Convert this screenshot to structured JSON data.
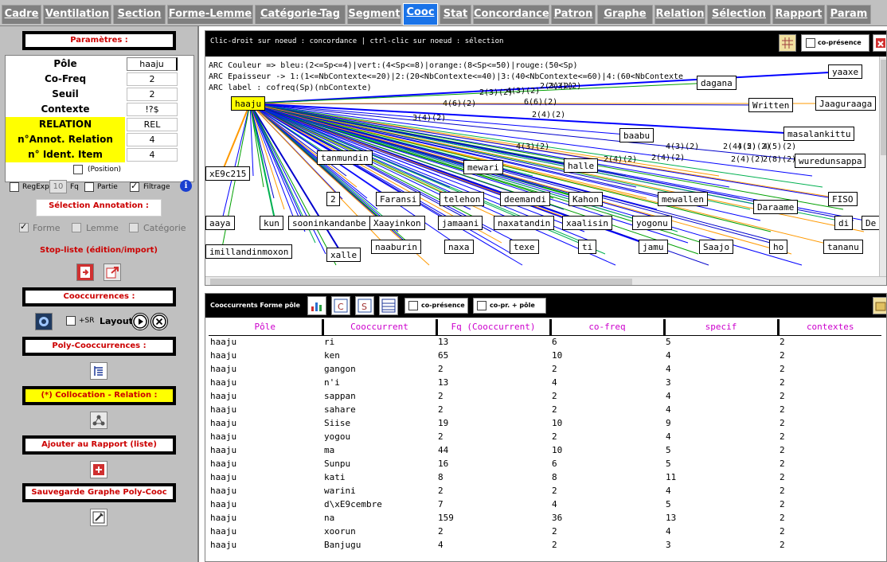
{
  "tabs": [
    {
      "label": "Cadre",
      "active": false
    },
    {
      "label": "Ventilation",
      "active": false
    },
    {
      "label": "Section",
      "active": false
    },
    {
      "label": "Forme-Lemme",
      "active": false
    },
    {
      "label": "Catégorie-Tag",
      "active": false
    },
    {
      "label": "Segment",
      "active": false
    },
    {
      "label": "Cooc",
      "active": true
    },
    {
      "label": "Stat",
      "active": false
    },
    {
      "label": "Concordance",
      "active": false
    },
    {
      "label": "Patron",
      "active": false
    },
    {
      "label": "Graphe",
      "active": false
    },
    {
      "label": "Relation",
      "active": false
    },
    {
      "label": "Sélection",
      "active": false
    },
    {
      "label": "Rapport",
      "active": false
    },
    {
      "label": "Param",
      "active": false
    }
  ],
  "left": {
    "params_title": "Paramètres :",
    "params": [
      {
        "label": "Pôle",
        "value": "haaju",
        "highlight": false
      },
      {
        "label": "Co-Freq",
        "value": "2",
        "highlight": false
      },
      {
        "label": "Seuil",
        "value": "2",
        "highlight": false
      },
      {
        "label": "Contexte",
        "value": "!?$",
        "highlight": false
      },
      {
        "label": "RELATION",
        "value": "REL",
        "highlight": true
      },
      {
        "label": "n°Annot. Relation",
        "value": "4",
        "highlight": true
      },
      {
        "label": "n° Ident. Item",
        "value": "4",
        "highlight": true
      }
    ],
    "position_label": "(Position)",
    "regexp_label": "RegExp",
    "fq_value": "10",
    "fq_label": "Fq",
    "partie_label": "Partie",
    "filtrage_label": "Filtrage",
    "selection_title": "Sélection Annotation :",
    "forme_label": "Forme",
    "lemme_label": "Lemme",
    "categorie_label": "Catégorie",
    "stoplist_label": "Stop-liste (édition/import)",
    "cooccurrences_title": "Cooccurrences :",
    "sr_label": "+SR",
    "layout_label": "Layout",
    "poly_title": "Poly-Cooccurrences :",
    "collocation_title": "(*) Collocation - Relation :",
    "ajouter_title": "Ajouter au Rapport (liste)",
    "sauvegarde_title": "Sauvegarde Graphe Poly-Cooc"
  },
  "graph": {
    "header_text": "Clic-droit sur noeud : concordance | ctrl-clic sur noeud : sélection",
    "copresence_label": "co-présence",
    "legend": [
      "ARC Couleur => bleu:(2<=Sp<=4)|vert:(4<Sp<=8)|orange:(8<Sp<=50)|rouge:(50<Sp)",
      "ARC Epaisseur -> 1:(1<=NbContexte<=20)|2:(20<NbContexte<=40)|3:(40<NbContexte<=60)|4:(60<NbContexte",
      "ARC label : cofreq(Sp)(nbContexte)"
    ],
    "center_node": "haaju",
    "nodes": [
      {
        "label": "yaaxe"
      },
      {
        "label": "dagana"
      },
      {
        "label": "Written"
      },
      {
        "label": "Jaaguraaga"
      },
      {
        "label": "baabu"
      },
      {
        "label": "masalankittu"
      },
      {
        "label": "tanmundin"
      },
      {
        "label": "mewari"
      },
      {
        "label": "halle"
      },
      {
        "label": "wuredunsappa"
      },
      {
        "label": "xE9c215"
      },
      {
        "label": "2"
      },
      {
        "label": "Faransi"
      },
      {
        "label": "telehon"
      },
      {
        "label": "deemandi"
      },
      {
        "label": "Kahon"
      },
      {
        "label": "mewallen"
      },
      {
        "label": "FISO"
      },
      {
        "label": "Daraame"
      },
      {
        "label": "aaya"
      },
      {
        "label": "kun"
      },
      {
        "label": "sooninkandanbe"
      },
      {
        "label": "Xaayinkon"
      },
      {
        "label": "jamaani"
      },
      {
        "label": "naxatandin"
      },
      {
        "label": "xaalisin"
      },
      {
        "label": "yogonu"
      },
      {
        "label": "di"
      },
      {
        "label": "De"
      },
      {
        "label": "imillandinmoxon"
      },
      {
        "label": "xalle"
      },
      {
        "label": "naaburin"
      },
      {
        "label": "naxa"
      },
      {
        "label": "texe"
      },
      {
        "label": "ti"
      },
      {
        "label": "jamu"
      },
      {
        "label": "Saajo"
      },
      {
        "label": "ho"
      },
      {
        "label": "tananu"
      }
    ],
    "arc_labels": [
      "2(3)(2)",
      "4(3)(2)",
      "2(3)(2)",
      "4(6)(2)",
      "6(6)(2)",
      "2(4)(2)",
      "3(4)(2)",
      "4(3)(2)",
      "2(4)(2)",
      "2(4)(2)",
      "4(5)(2)",
      "2(8)(2)",
      "2(4)(2)",
      "2(4)(2)",
      "2(4)(2)",
      "4(5)(2)",
      "4(3)(2)",
      "2(3)(2)"
    ]
  },
  "table": {
    "header_text": "Cooccurrents Forme pôle",
    "copresence_label": "co-présence",
    "copr_pole_label": "co-pr. + pôle",
    "columns": [
      "Pôle",
      "Cooccurrent",
      "Fq (Cooccurrent)",
      "co-freq",
      "specif",
      "contextes"
    ],
    "rows": [
      [
        "haaju",
        "ri",
        "13",
        "6",
        "5",
        "2"
      ],
      [
        "haaju",
        "ken",
        "65",
        "10",
        "4",
        "2"
      ],
      [
        "haaju",
        "gangon",
        "2",
        "2",
        "4",
        "2"
      ],
      [
        "haaju",
        "n'i",
        "13",
        "4",
        "3",
        "2"
      ],
      [
        "haaju",
        "sappan",
        "2",
        "2",
        "4",
        "2"
      ],
      [
        "haaju",
        "sahare",
        "2",
        "2",
        "4",
        "2"
      ],
      [
        "haaju",
        "Siise",
        "19",
        "10",
        "9",
        "2"
      ],
      [
        "haaju",
        "yogou",
        "2",
        "2",
        "4",
        "2"
      ],
      [
        "haaju",
        "ma",
        "44",
        "10",
        "5",
        "2"
      ],
      [
        "haaju",
        "Sunpu",
        "16",
        "6",
        "5",
        "2"
      ],
      [
        "haaju",
        "kati",
        "8",
        "8",
        "11",
        "2"
      ],
      [
        "haaju",
        "warini",
        "2",
        "2",
        "4",
        "2"
      ],
      [
        "haaju",
        "d\\xE9cembre",
        "7",
        "4",
        "5",
        "2"
      ],
      [
        "haaju",
        "na",
        "159",
        "36",
        "13",
        "2"
      ],
      [
        "haaju",
        "xoorun",
        "2",
        "2",
        "4",
        "2"
      ],
      [
        "haaju",
        "Banjugu",
        "4",
        "2",
        "3",
        "2"
      ]
    ]
  },
  "colors": {
    "accent_tab": "#1a73e8",
    "section_red": "#cc0000",
    "highlight_yellow": "#ffff00",
    "column_header": "#cc00cc"
  }
}
